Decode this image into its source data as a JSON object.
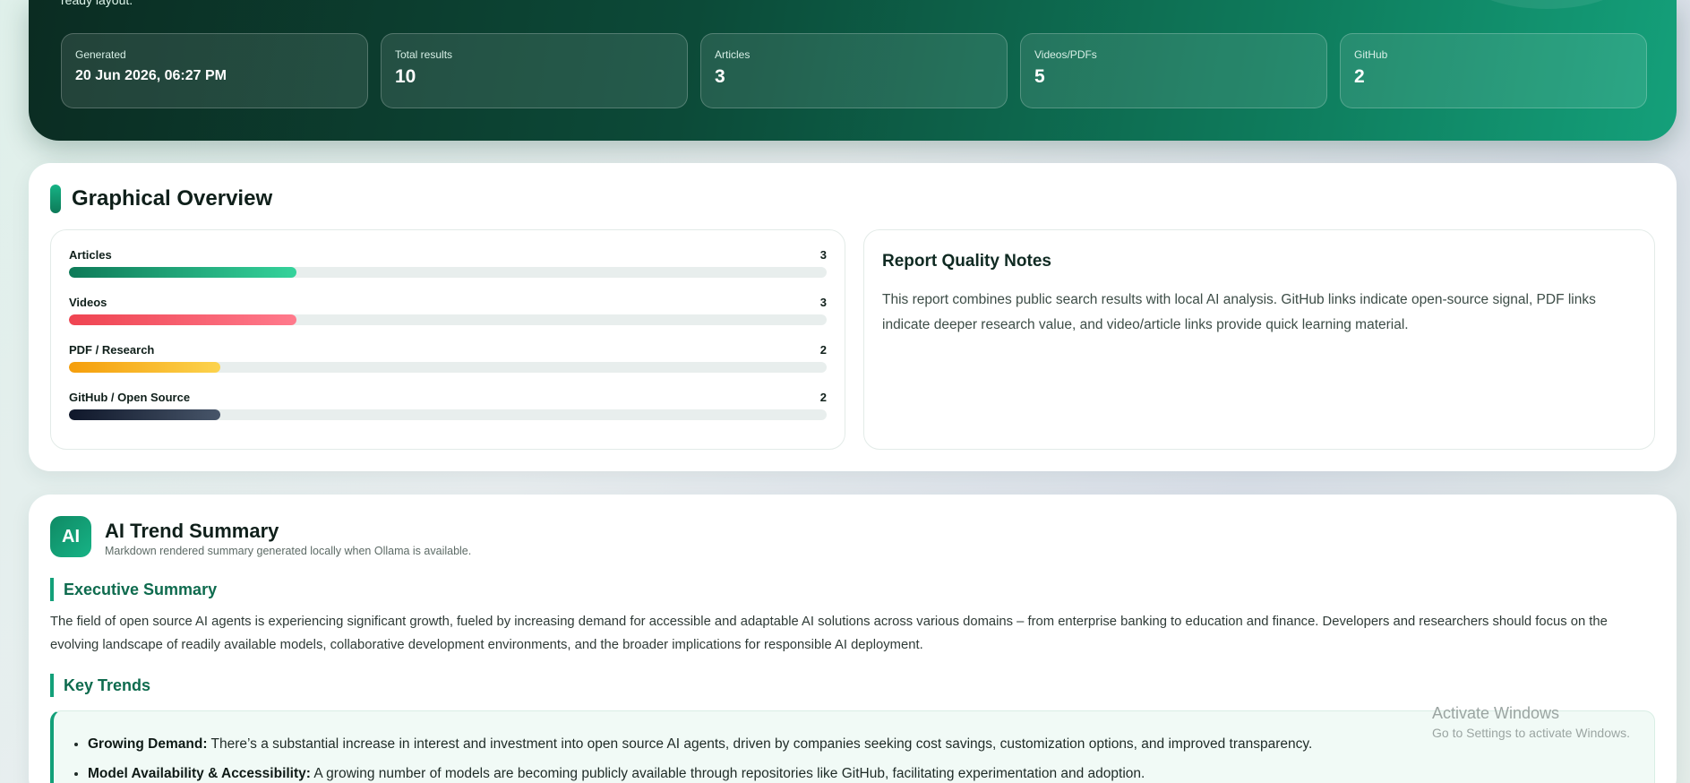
{
  "hero": {
    "description": "ready layout.",
    "stats": [
      {
        "label": "Generated",
        "value": "20 Jun 2026, 06:27 PM"
      },
      {
        "label": "Total results",
        "value": "10"
      },
      {
        "label": "Articles",
        "value": "3"
      },
      {
        "label": "Videos/PDFs",
        "value": "5"
      },
      {
        "label": "GitHub",
        "value": "2"
      }
    ]
  },
  "overview": {
    "title": "Graphical Overview",
    "bars": [
      {
        "label": "Articles",
        "count": "3",
        "fraction": 0.3
      },
      {
        "label": "Videos",
        "count": "3",
        "fraction": 0.3
      },
      {
        "label": "PDF / Research",
        "count": "2",
        "fraction": 0.2
      },
      {
        "label": "GitHub / Open Source",
        "count": "2",
        "fraction": 0.2
      }
    ],
    "notes": {
      "title": "Report Quality Notes",
      "text": "This report combines public search results with local AI analysis. GitHub links indicate open-source signal, PDF links indicate deeper research value, and video/article links provide quick learning material."
    }
  },
  "summary": {
    "badge": "AI",
    "title": "AI Trend Summary",
    "subtitle": "Markdown rendered summary generated locally when Ollama is available.",
    "exec_heading": "Executive Summary",
    "exec_text": "The field of open source AI agents is experiencing significant growth, fueled by increasing demand for accessible and adaptable AI solutions across various domains – from enterprise banking to education and finance. Developers and researchers should focus on the evolving landscape of readily available models, collaborative development environments, and the broader implications for responsible AI deployment.",
    "trends_heading": "Key Trends",
    "trends": [
      {
        "term": "Growing Demand:",
        "text": " There’s a substantial increase in interest and investment into open source AI agents, driven by companies seeking cost savings, customization options, and improved transparency."
      },
      {
        "term": "Model Availability & Accessibility:",
        "text": " A growing number of models are becoming publicly available through repositories like GitHub, facilitating experimentation and adoption."
      }
    ]
  },
  "watermark": {
    "title": "Activate Windows",
    "subtitle": "Go to Settings to activate Windows."
  }
}
